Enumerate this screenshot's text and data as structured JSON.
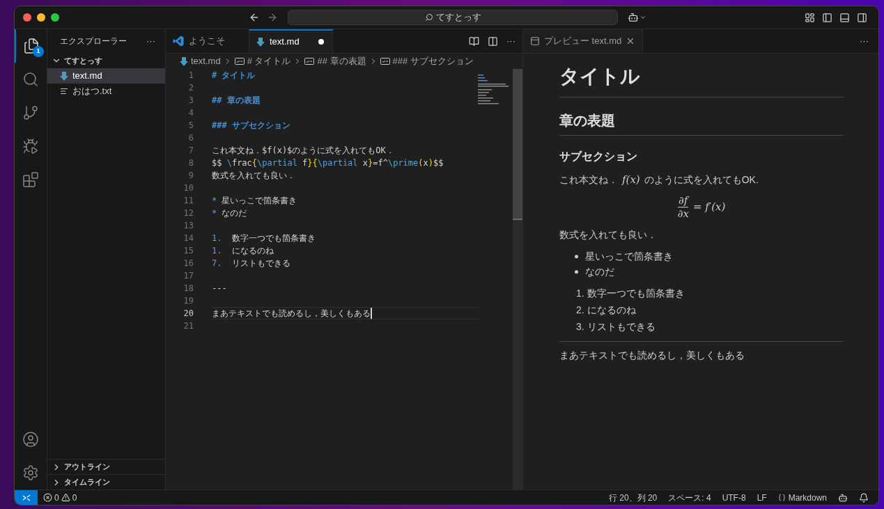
{
  "title_bar": {
    "search": "てすとっす"
  },
  "activity_bar": {
    "explorer_badge": "1"
  },
  "sidebar": {
    "title": "エクスプローラー",
    "more": "···",
    "folder": {
      "name": "てすとっす",
      "expanded": true,
      "files": [
        {
          "name": "text.md",
          "kind": "markdown",
          "selected": true
        },
        {
          "name": "おはつ.txt",
          "kind": "text",
          "selected": false
        }
      ]
    },
    "sections": [
      {
        "name": "アウトライン",
        "expanded": false
      },
      {
        "name": "タイムライン",
        "expanded": false
      }
    ]
  },
  "editor": {
    "tabs": [
      {
        "label": "ようこそ",
        "kind": "welcome",
        "selected": false,
        "dirty": false
      },
      {
        "label": "text.md",
        "kind": "markdown",
        "selected": true,
        "dirty": true
      }
    ],
    "more": "···",
    "breadcrumb": [
      {
        "label": "text.md",
        "kind": "file"
      },
      {
        "label": "# タイトル",
        "kind": "symbol"
      },
      {
        "label": "## 章の表題",
        "kind": "symbol"
      },
      {
        "label": "### サブセクション",
        "kind": "symbol"
      }
    ],
    "lines": [
      {
        "number": "1",
        "current": false,
        "segments": [
          {
            "text": "# タイトル",
            "kind": "heading"
          }
        ]
      },
      {
        "number": "2",
        "current": false
      },
      {
        "number": "3",
        "current": false,
        "segments": [
          {
            "text": "## 章の表題",
            "kind": "heading"
          }
        ]
      },
      {
        "number": "4",
        "current": false
      },
      {
        "number": "5",
        "current": false,
        "segments": [
          {
            "text": "### サブセクション",
            "kind": "heading"
          }
        ]
      },
      {
        "number": "6",
        "current": false
      },
      {
        "number": "7",
        "current": false,
        "segments": [
          {
            "text": "これ本文ね．$f(x)$のように式を入れてもOK．",
            "kind": "plain"
          }
        ]
      },
      {
        "number": "8",
        "current": false,
        "segments": [
          {
            "text": "$$ ",
            "kind": "plain"
          },
          {
            "text": "\\",
            "kind": "command"
          },
          {
            "text": "frac",
            "kind": "plain"
          },
          {
            "text": "{",
            "kind": "brace"
          },
          {
            "text": "\\partial",
            "kind": "command"
          },
          {
            "text": " f",
            "kind": "plain"
          },
          {
            "text": "}{",
            "kind": "brace"
          },
          {
            "text": "\\partial",
            "kind": "command"
          },
          {
            "text": " x",
            "kind": "plain"
          },
          {
            "text": "}",
            "kind": "brace"
          },
          {
            "text": "=f^",
            "kind": "plain"
          },
          {
            "text": "\\prime",
            "kind": "command"
          },
          {
            "text": "(",
            "kind": "brace"
          },
          {
            "text": "x",
            "kind": "plain"
          },
          {
            "text": ")",
            "kind": "brace"
          },
          {
            "text": "$$",
            "kind": "plain"
          }
        ]
      },
      {
        "number": "9",
        "current": false,
        "segments": [
          {
            "text": "数式を入れても良い．",
            "kind": "plain"
          }
        ]
      },
      {
        "number": "10",
        "current": false
      },
      {
        "number": "11",
        "current": false,
        "segments": [
          {
            "text": "*",
            "kind": "listmark"
          },
          {
            "text": " 星いっこで箇条書き",
            "kind": "plain"
          }
        ]
      },
      {
        "number": "12",
        "current": false,
        "segments": [
          {
            "text": "*",
            "kind": "listmark"
          },
          {
            "text": " なのだ",
            "kind": "plain"
          }
        ]
      },
      {
        "number": "13",
        "current": false
      },
      {
        "number": "14",
        "current": false,
        "segments": [
          {
            "text": "1.",
            "kind": "listmark"
          },
          {
            "text": "  数字一つでも箇条書き",
            "kind": "plain"
          }
        ]
      },
      {
        "number": "15",
        "current": false,
        "segments": [
          {
            "text": "1.",
            "kind": "listmark"
          },
          {
            "text": "  になるのね",
            "kind": "plain"
          }
        ]
      },
      {
        "number": "16",
        "current": false,
        "segments": [
          {
            "text": "7.",
            "kind": "listmark"
          },
          {
            "text": "  リストもできる",
            "kind": "plain"
          }
        ]
      },
      {
        "number": "17",
        "current": false
      },
      {
        "number": "18",
        "current": false,
        "segments": [
          {
            "text": "---",
            "kind": "plain"
          }
        ]
      },
      {
        "number": "19",
        "current": false
      },
      {
        "number": "20",
        "current": true,
        "segments": [
          {
            "text": "まあテキストでも読めるし，美しくもある",
            "kind": "plain"
          }
        ]
      },
      {
        "number": "21",
        "current": false
      }
    ]
  },
  "preview": {
    "tab": {
      "label": "プレビュー text.md",
      "selected": true
    },
    "more": "···",
    "blocks": [
      {
        "kind": "h1",
        "text": "タイトル"
      },
      {
        "kind": "h2",
        "text": "章の表題"
      },
      {
        "kind": "h3",
        "text": "サブセクション"
      },
      {
        "kind": "paragraph",
        "parts": [
          {
            "text": "これ本文ね．",
            "kind": "text"
          },
          {
            "text": "f(x)",
            "kind": "math"
          },
          {
            "text": "のように式を入れてもOK.",
            "kind": "text"
          }
        ]
      },
      {
        "kind": "fraction",
        "numerator": "∂f",
        "denominator": "∂x",
        "rest": "= f′(x)"
      },
      {
        "kind": "paragraph",
        "parts": [
          {
            "text": "数式を入れても良い．",
            "kind": "text"
          }
        ]
      },
      {
        "kind": "bullets",
        "items": [
          "星いっこで箇条書き",
          "なのだ"
        ]
      },
      {
        "kind": "ordered",
        "items": [
          {
            "marker": "1.",
            "text": "数字一つでも箇条書き"
          },
          {
            "marker": "2.",
            "text": "になるのね"
          },
          {
            "marker": "3.",
            "text": "リストもできる"
          }
        ]
      },
      {
        "kind": "rule"
      },
      {
        "kind": "paragraph",
        "parts": [
          {
            "text": "まあテキストでも読めるし，美しくもある",
            "kind": "text"
          }
        ]
      }
    ]
  },
  "status_bar": {
    "errors": "0",
    "warnings": "0",
    "position": "行 20、列 20",
    "indent": "スペース: 4",
    "encoding": "UTF-8",
    "eol": "LF",
    "language": "Markdown"
  }
}
